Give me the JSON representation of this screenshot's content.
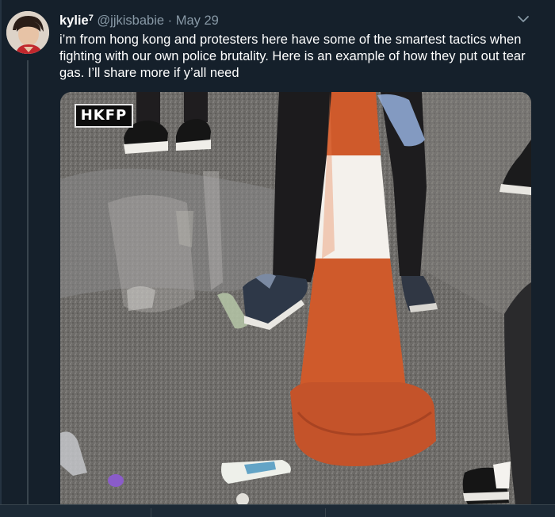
{
  "tweet": {
    "display_name": "kylie",
    "superscript": "7",
    "handle": "@jjkisbabie",
    "separator": "·",
    "date": "May 29",
    "text": "i’m from hong kong and protesters here have some of the smartest tactics when fighting with our own police brutality. Here is an example of how they put out tear gas. I’ll share more if y’all need",
    "menu_icon": "chevron-down-icon"
  },
  "media": {
    "watermark": "HKFP"
  },
  "colors": {
    "background": "#15202b",
    "text_primary": "#ffffff",
    "text_secondary": "#8899a6",
    "cone_orange": "#cf5a2b",
    "cone_white": "#f4f1ec"
  }
}
